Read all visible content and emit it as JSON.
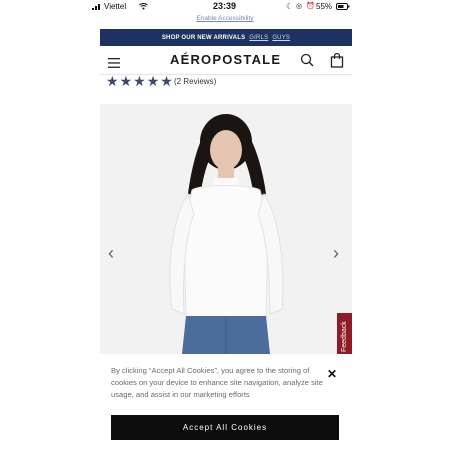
{
  "status_bar": {
    "carrier": "Viettel",
    "time": "23:39",
    "battery": "55%"
  },
  "accessibility": {
    "link": "Enable Accessibility"
  },
  "promo": {
    "text": "SHOP OUR NEW ARRIVALS",
    "link_girls": "GIRLS",
    "link_guys": "GUYS"
  },
  "header": {
    "logo": "AÉROPOSTALE"
  },
  "product": {
    "rating": 5,
    "reviews": "(2 Reviews)"
  },
  "carousel": {
    "prev": "‹",
    "next": "›"
  },
  "feedback": {
    "label": "Feedback"
  },
  "cookie_banner": {
    "text": "By clicking “Accept All Cookies”, you agree to the storing of cookies on your device to enhance site navigation, analyze site usage, and assist in our marketing efforts",
    "accept_label": "Accept All Cookies",
    "close_label": "✕"
  },
  "colors": {
    "promo_bg": "#1d3162",
    "feedback_bg": "#8e1b27",
    "accept_bg": "#0d0d0d",
    "star_color": "#3c4a6b"
  }
}
